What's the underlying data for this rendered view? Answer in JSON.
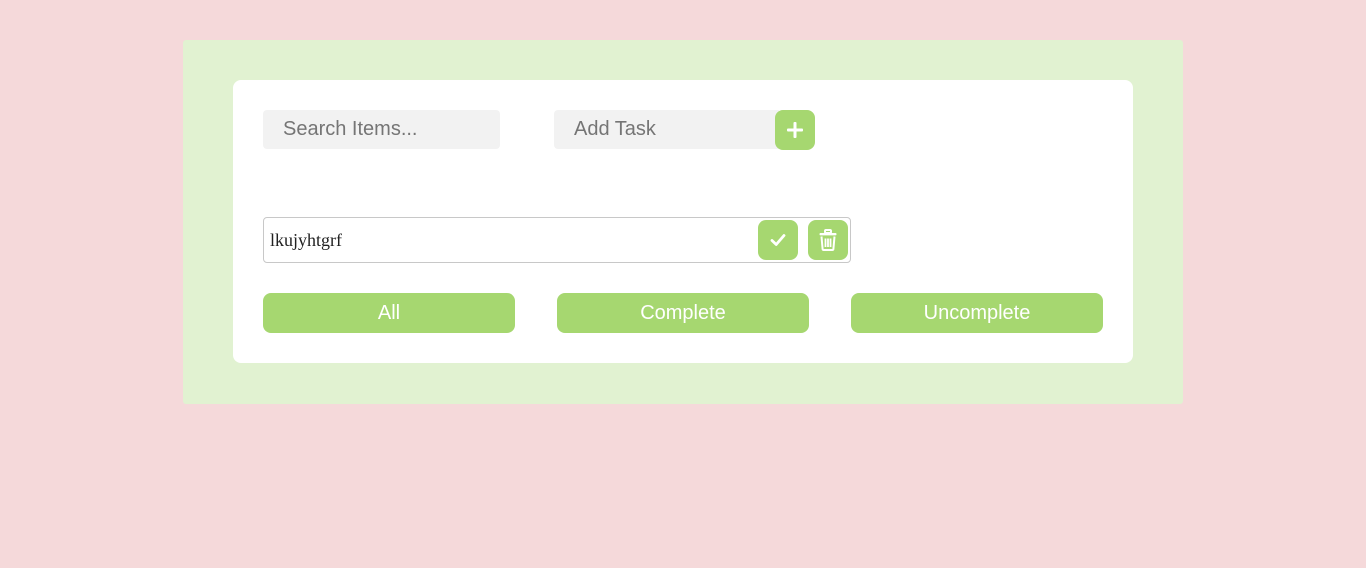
{
  "search": {
    "placeholder": "Search Items..."
  },
  "add_task": {
    "placeholder": "Add Task",
    "button_icon": "plus-icon"
  },
  "tasks": [
    {
      "text": "lkujyhtgrf",
      "complete_icon": "check-icon",
      "delete_icon": "trash-icon"
    }
  ],
  "filters": {
    "all": "All",
    "complete": "Complete",
    "uncomplete": "Uncomplete"
  },
  "colors": {
    "page_background": "#f5d9da",
    "outer_panel": "#e1f2d1",
    "card": "#ffffff",
    "accent": "#a6d770",
    "input_background": "#f2f2f2"
  }
}
